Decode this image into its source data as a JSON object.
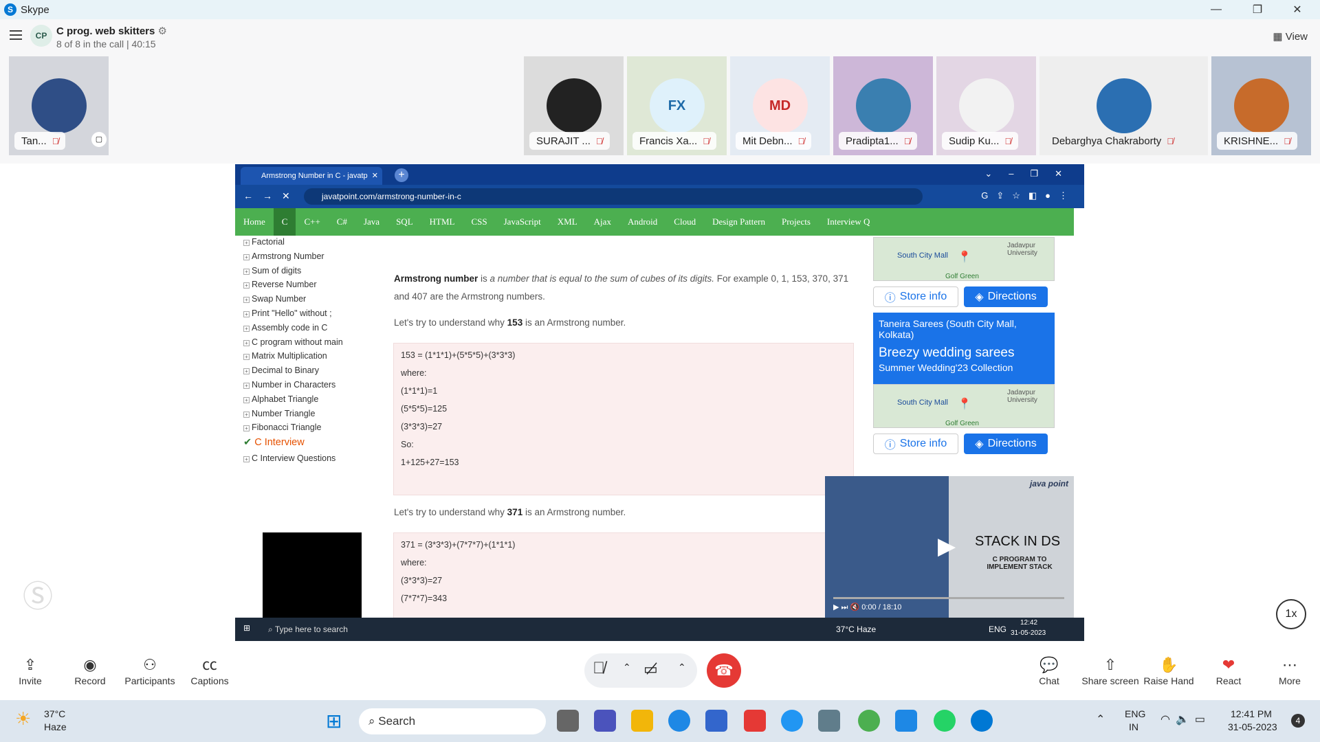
{
  "app": {
    "title": "Skype"
  },
  "call": {
    "title": "C prog. web skitters",
    "subtitle": "8 of 8 in the call | 40:15",
    "view_label": "View",
    "badge": "CP"
  },
  "participants": [
    {
      "name": "Tan...",
      "initials": ""
    },
    {
      "name": "SURAJIT ...",
      "initials": ""
    },
    {
      "name": "Francis Xa...",
      "initials": "FX"
    },
    {
      "name": "Mit Debn...",
      "initials": "MD"
    },
    {
      "name": "Pradipta1...",
      "initials": ""
    },
    {
      "name": "Sudip Ku...",
      "initials": ""
    },
    {
      "name": "Debarghya Chakraborty",
      "initials": ""
    },
    {
      "name": "KRISHNE...",
      "initials": ""
    }
  ],
  "browser": {
    "tab_title": "Armstrong Number in C - javatp",
    "url": "javatpoint.com/armstrong-number-in-c",
    "menu": [
      "Home",
      "C",
      "C++",
      "C#",
      "Java",
      "SQL",
      "HTML",
      "CSS",
      "JavaScript",
      "XML",
      "Ajax",
      "Android",
      "Cloud",
      "Design Pattern",
      "Projects",
      "Interview Q"
    ],
    "sidebar": [
      "Factorial",
      "Armstrong Number",
      "Sum of digits",
      "Reverse Number",
      "Swap Number",
      "Print \"Hello\" without ;",
      "Assembly code in C",
      "C program without main",
      "Matrix Multiplication",
      "Decimal to Binary",
      "Number in Characters",
      "Alphabet Triangle",
      "Number Triangle",
      "Fibonacci Triangle"
    ],
    "sidebar_section": "C Interview",
    "sidebar_last": "C Interview Questions",
    "intro_bold": "Armstrong number",
    "intro_is": " is ",
    "intro_italic": "a number that is equal to the sum of cubes of its digits.",
    "intro_rest": " For example 0, 1, 153, 370, 371 and 407 are the Armstrong numbers.",
    "why153_a": "Let's try to understand why ",
    "why153_b": "153",
    "why153_c": " is an Armstrong number.",
    "code153": [
      "153 = (1*1*1)+(5*5*5)+(3*3*3)",
      "where:",
      "(1*1*1)=1",
      "(5*5*5)=125",
      "(3*3*3)=27",
      "So:",
      "1+125+27=153"
    ],
    "why371_b": "371",
    "code371": [
      "371 = (3*3*3)+(7*7*7)+(1*1*1)",
      "where:",
      "(3*3*3)=27",
      "(7*7*7)=343"
    ],
    "ad": {
      "map_label": "South City Mall",
      "map_label2": "Jadavpur University",
      "map_label3": "Golf Green",
      "store": "Store info",
      "directions": "Directions",
      "headline": "Taneira Sarees (South City Mall, Kolkata)",
      "big": "Breezy wedding sarees",
      "sub": "Summer Wedding'23 Collection"
    },
    "video": {
      "brand": "java point",
      "title": "STACK IN DS",
      "subtitle": "C PROGRAM TO IMPLEMENT STACK",
      "time": "0:00 / 18:10"
    },
    "inner_taskbar": {
      "search": "Type here to search",
      "weather": "37°C  Haze",
      "lang": "ENG",
      "time": "12:42",
      "date": "31-05-2023"
    }
  },
  "speed": "1x",
  "controls": {
    "invite": "Invite",
    "record": "Record",
    "participants": "Participants",
    "captions": "Captions",
    "chat": "Chat",
    "share": "Share screen",
    "raise": "Raise Hand",
    "react": "React",
    "more": "More"
  },
  "taskbar": {
    "temp": "37°C",
    "weather": "Haze",
    "search": "Search",
    "lang1": "ENG",
    "lang2": "IN",
    "time": "12:41 PM",
    "date": "31-05-2023",
    "notif": "4"
  },
  "colors": {
    "menu_green": "#4caf50",
    "skype_blue": "#0078d4",
    "end_call_red": "#e53935"
  }
}
